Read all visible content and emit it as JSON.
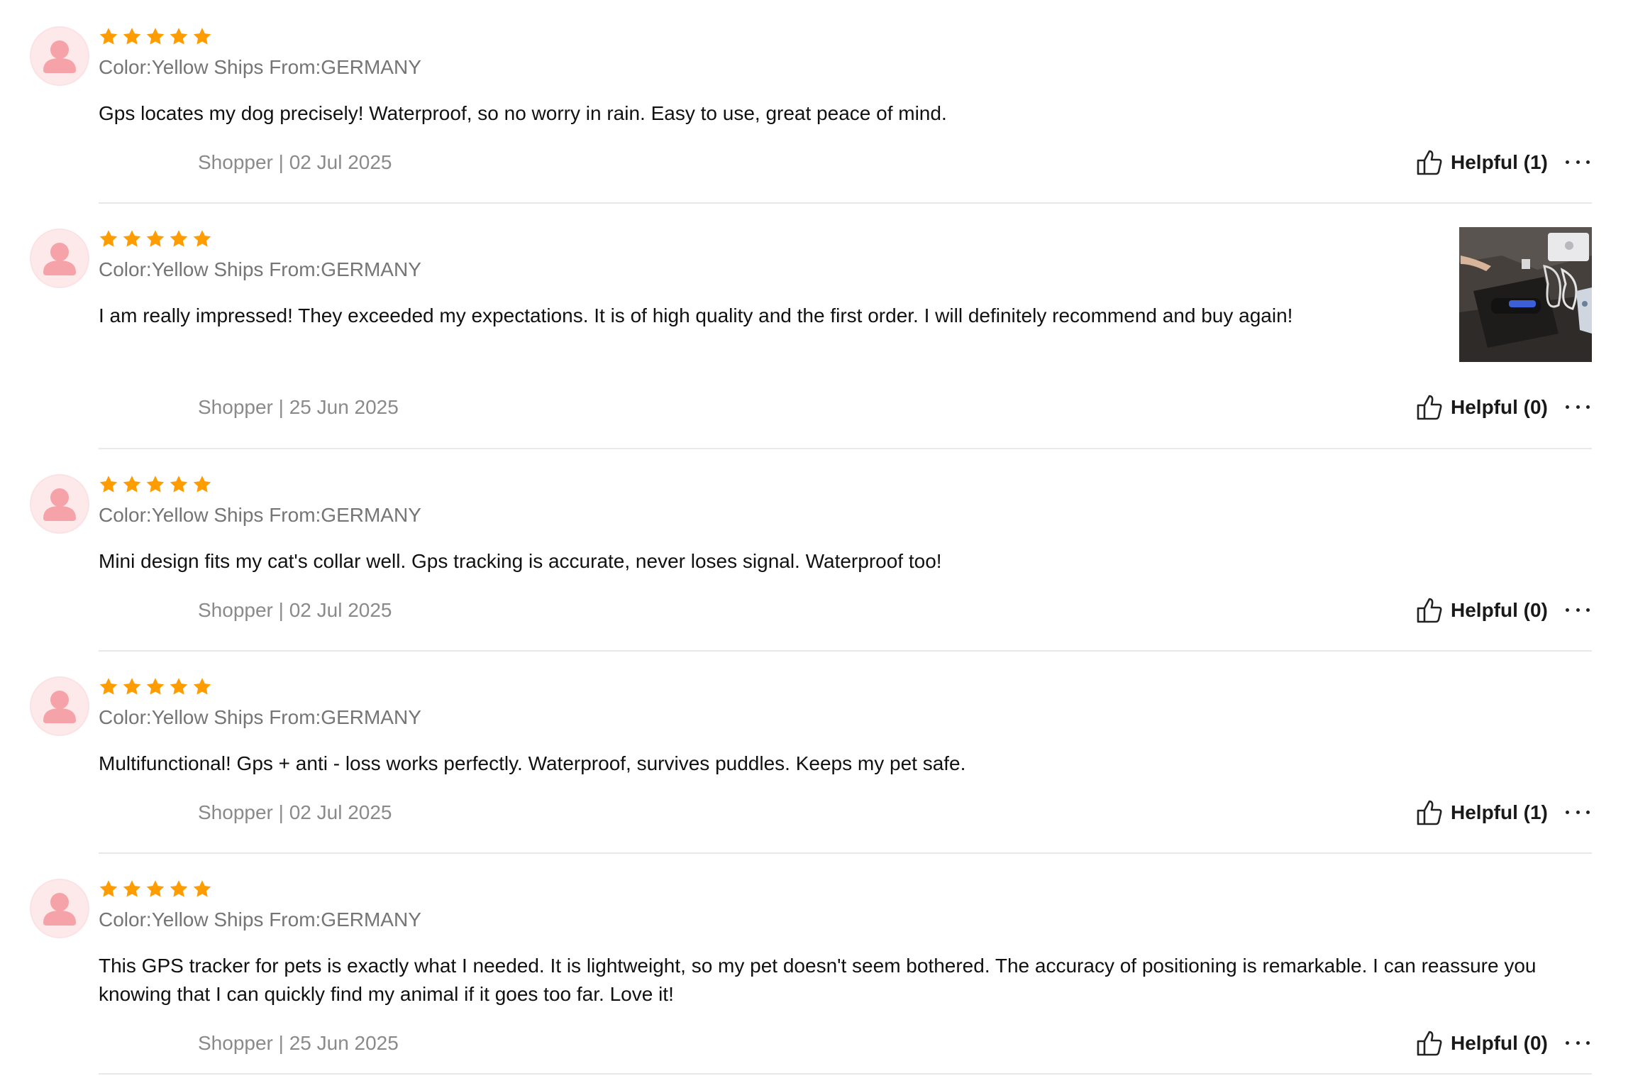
{
  "colors": {
    "star": "#ff9c00",
    "avatar_bg": "#fde8ea",
    "avatar_figure": "#f5a3a8",
    "meta_text": "#757575",
    "divider": "#e8e8e8"
  },
  "icons": {
    "avatar": "user-avatar-icon",
    "star": "star-icon",
    "helpful": "thumbs-up-icon",
    "more": "more-options-icon"
  },
  "reviews": [
    {
      "rating": 5,
      "meta": "Color:Yellow Ships From:GERMANY",
      "text": "Gps locates my dog precisely! Waterproof, so no worry in rain. Easy to use, great peace of mind.",
      "footer": "Shopper | 02 Jul 2025",
      "helpful_label": "Helpful (1)",
      "has_photo": false
    },
    {
      "rating": 5,
      "meta": "Color:Yellow Ships From:GERMANY",
      "text": "I am really impressed! They exceeded my expectations. It is of high quality and the first order. I will definitely recommend and buy again!",
      "footer": "Shopper | 25 Jun 2025",
      "helpful_label": "Helpful (0)",
      "has_photo": true
    },
    {
      "rating": 5,
      "meta": "Color:Yellow Ships From:GERMANY",
      "text": "Mini design fits my cat's collar well. Gps tracking is accurate, never loses signal. Waterproof too!",
      "footer": "Shopper | 02 Jul 2025",
      "helpful_label": "Helpful (0)",
      "has_photo": false
    },
    {
      "rating": 5,
      "meta": "Color:Yellow Ships From:GERMANY",
      "text": "Multifunctional! Gps + anti - loss works perfectly. Waterproof, survives puddles. Keeps my pet safe.",
      "footer": "Shopper | 02 Jul 2025",
      "helpful_label": "Helpful (1)",
      "has_photo": false
    },
    {
      "rating": 5,
      "meta": "Color:Yellow Ships From:GERMANY",
      "text": "This GPS tracker for pets is exactly what I needed. It is lightweight, so my pet doesn't seem bothered. The accuracy of positioning is remarkable. I can reassure you knowing that I can quickly find my animal if it goes too far. Love it!",
      "footer": "Shopper | 25 Jun 2025",
      "helpful_label": "Helpful (0)",
      "has_photo": false
    }
  ]
}
